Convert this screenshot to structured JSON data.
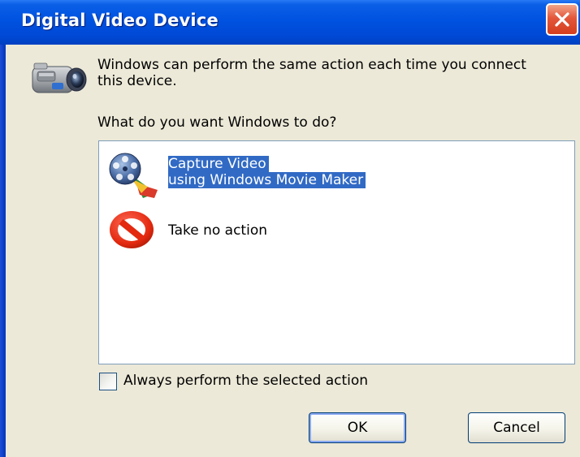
{
  "window": {
    "title": "Digital Video Device"
  },
  "icons": {
    "close": "close-icon",
    "device": "video-camera-icon",
    "movie_maker": "movie-maker-icon",
    "no_action": "no-action-icon"
  },
  "message": "Windows can perform the same action each time you connect this device.",
  "question": "What do you want Windows to do?",
  "actions": [
    {
      "line1": "Capture Video",
      "line2": "using Windows Movie Maker",
      "selected": true
    },
    {
      "line1": "Take no action",
      "selected": false
    }
  ],
  "always_perform": {
    "label": "Always perform the selected action",
    "checked": false
  },
  "buttons": {
    "ok": "OK",
    "cancel": "Cancel"
  },
  "colors": {
    "titlebar": "#0052e0",
    "selection": "#316ac5",
    "close_button": "#e3573a",
    "dialog_background": "#ece9d8"
  }
}
